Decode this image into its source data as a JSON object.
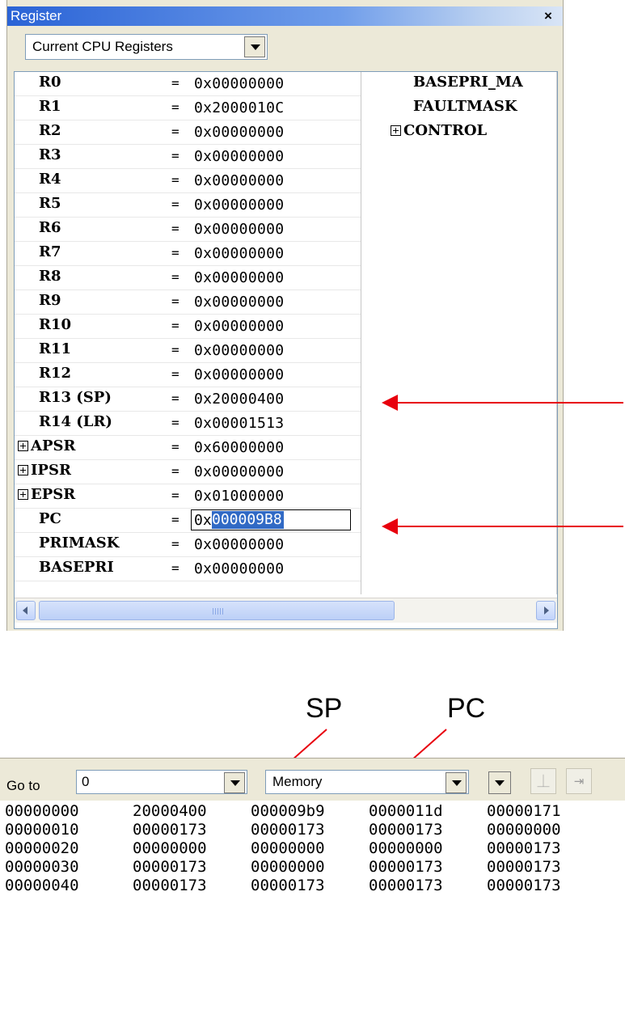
{
  "register_window": {
    "title": "Register",
    "close_glyph": "×",
    "view_select": "Current CPU Registers",
    "rows": [
      {
        "name": "R0",
        "eq": "=",
        "value": "0x00000000"
      },
      {
        "name": "R1",
        "eq": "=",
        "value": "0x2000010C"
      },
      {
        "name": "R2",
        "eq": "=",
        "value": "0x00000000"
      },
      {
        "name": "R3",
        "eq": "=",
        "value": "0x00000000"
      },
      {
        "name": "R4",
        "eq": "=",
        "value": "0x00000000"
      },
      {
        "name": "R5",
        "eq": "=",
        "value": "0x00000000"
      },
      {
        "name": "R6",
        "eq": "=",
        "value": "0x00000000"
      },
      {
        "name": "R7",
        "eq": "=",
        "value": "0x00000000"
      },
      {
        "name": "R8",
        "eq": "=",
        "value": "0x00000000"
      },
      {
        "name": "R9",
        "eq": "=",
        "value": "0x00000000"
      },
      {
        "name": "R10",
        "eq": "=",
        "value": "0x00000000"
      },
      {
        "name": "R11",
        "eq": "=",
        "value": "0x00000000"
      },
      {
        "name": "R12",
        "eq": "=",
        "value": "0x00000000"
      },
      {
        "name": "R13 (SP)",
        "eq": "=",
        "value": "0x20000400"
      },
      {
        "name": "R14 (LR)",
        "eq": "=",
        "value": "0x00001513"
      },
      {
        "name": "APSR",
        "eq": "=",
        "value": "0x60000000"
      },
      {
        "name": "IPSR",
        "eq": "=",
        "value": "0x00000000"
      },
      {
        "name": "EPSR",
        "eq": "=",
        "value": "0x01000000"
      },
      {
        "name": "PC",
        "eq": "=",
        "value_prefix": "0x",
        "value_selected": "000009B8"
      },
      {
        "name": "PRIMASK",
        "eq": "=",
        "value": "0x00000000"
      },
      {
        "name": "BASEPRI",
        "eq": "=",
        "value": "0x00000000"
      }
    ],
    "right_rows": [
      {
        "name": "BASEPRI_MA"
      },
      {
        "name": "FAULTMASK"
      },
      {
        "name": "CONTROL"
      }
    ],
    "scroll_grip": "III"
  },
  "annotations": {
    "sp_label": "SP",
    "pc_label": "PC",
    "arrow_color": "#e8000d"
  },
  "memory_window": {
    "goto_label": "Go to",
    "address_value": "0",
    "memory_type": "Memory",
    "dump": [
      {
        "addr": "00000000",
        "words": [
          "20000400",
          "000009b9",
          "0000011d",
          "00000171"
        ]
      },
      {
        "addr": "00000010",
        "words": [
          "00000173",
          "00000173",
          "00000173",
          "00000000"
        ]
      },
      {
        "addr": "00000020",
        "words": [
          "00000000",
          "00000000",
          "00000000",
          "00000173"
        ]
      },
      {
        "addr": "00000030",
        "words": [
          "00000173",
          "00000000",
          "00000173",
          "00000173"
        ]
      },
      {
        "addr": "00000040",
        "words": [
          "00000173",
          "00000173",
          "00000173",
          "00000173"
        ]
      }
    ]
  }
}
